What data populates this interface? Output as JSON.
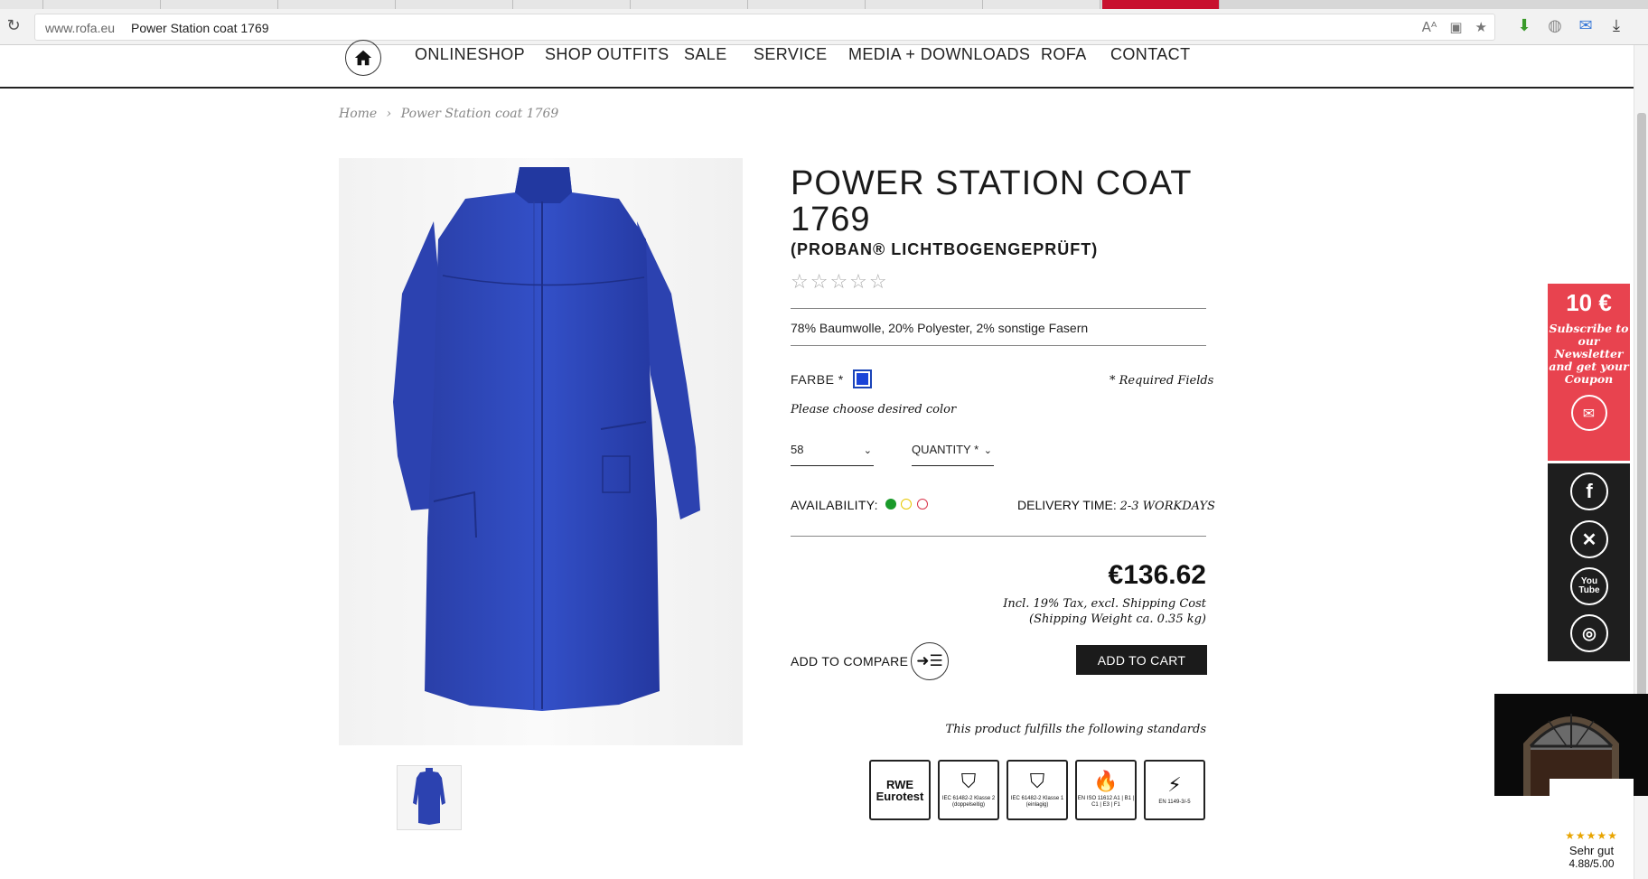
{
  "browser": {
    "url_host": "www.rofa.eu",
    "url_title": "Power Station coat 1769"
  },
  "nav": {
    "items": [
      "ONLINESHOP",
      "SHOP OUTFITS",
      "SALE",
      "SERVICE",
      "MEDIA + DOWNLOADS",
      "ROFA",
      "CONTACT"
    ]
  },
  "breadcrumb": {
    "home": "Home",
    "separator": "›",
    "current": "Power Station coat 1769"
  },
  "product": {
    "title": "POWER STATION COAT 1769",
    "subtitle": "(PROBAN® LICHTBOGENGEPRÜFT)",
    "rating_stars": 0,
    "rating_display": "☆☆☆☆☆",
    "material": "78% Baumwolle, 20% Polyester, 2% sonstige Fasern",
    "color_label": "FARBE *",
    "color_swatch": "#1a44d8",
    "required_note": "* Required Fields",
    "choose_color": "Please choose desired color",
    "size_value": "58",
    "quantity_label": "QUANTITY *",
    "availability_label": "AVAILABILITY:",
    "availability_colors": [
      "#1a9a2a",
      "#e8c800",
      "#d8344a"
    ],
    "delivery_label": "DELIVERY TIME:",
    "delivery_value": "2-3 WORKDAYS",
    "price": "€136.62",
    "tax_line1": "Incl. 19% Tax, excl. Shipping Cost",
    "tax_line2": "(Shipping Weight ca. 0.35 kg)",
    "compare_label": "ADD TO COMPARE",
    "cart_label": "ADD TO CART",
    "standards_text": "This product fulfills the following standards",
    "badges": [
      {
        "title": "RWE Eurotest",
        "text": ""
      },
      {
        "title": "",
        "text": "IEC 61482-2 Klasse 2 (doppelseitig)"
      },
      {
        "title": "",
        "text": "IEC 61482-2 Klasse 1 (einlagig)"
      },
      {
        "title": "",
        "text": "EN ISO 11612 A1 | B1 | C1 | E3 | F1"
      },
      {
        "title": "",
        "text": "EN 1149-3/-5"
      }
    ]
  },
  "newsletter": {
    "amount": "10 €",
    "text": "Subscribe to our Newsletter and get your Coupon"
  },
  "social": [
    "facebook-icon",
    "xing-icon",
    "youtube-icon",
    "instagram-icon"
  ],
  "trusted": {
    "stars": "★★★★★",
    "label": "Sehr gut",
    "score": "4.88/5.00"
  }
}
